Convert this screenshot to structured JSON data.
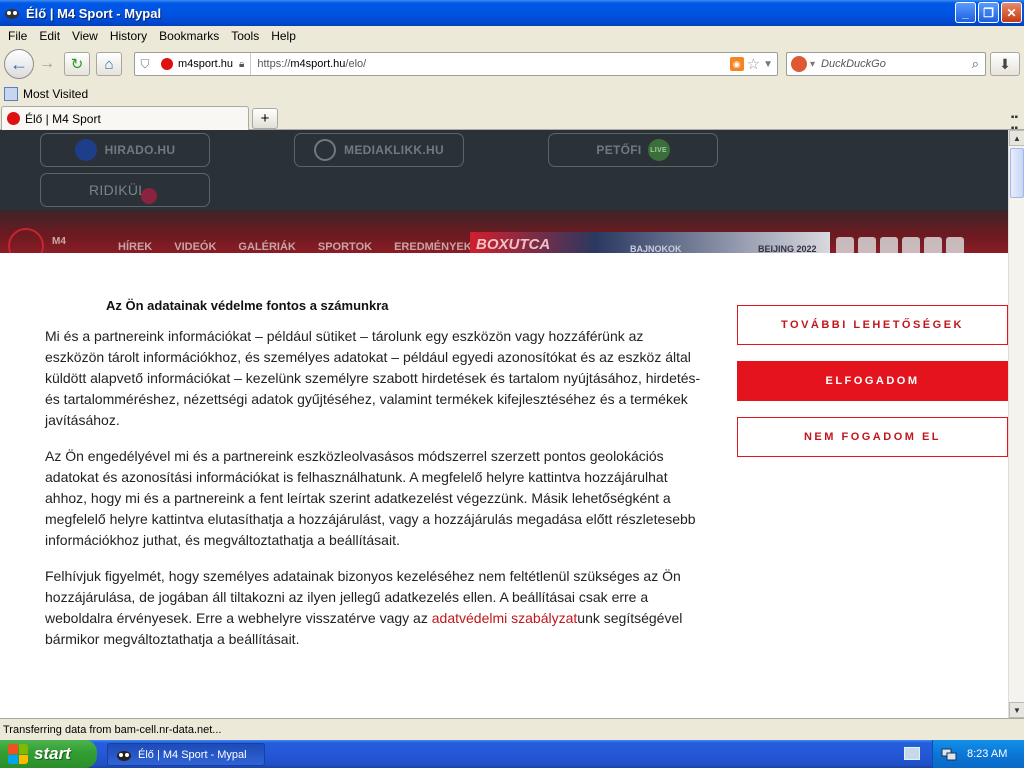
{
  "window": {
    "title": "Élő | M4 Sport - Mypal",
    "controls": {
      "minimize": "_",
      "maximize": "❐",
      "close": "✕"
    }
  },
  "menu": [
    "File",
    "Edit",
    "View",
    "History",
    "Bookmarks",
    "Tools",
    "Help"
  ],
  "nav": {
    "site_identity": "m4sport.hu",
    "url_prefix": "https://",
    "url_host": "m4sport.hu",
    "url_path": "/elo/",
    "search_placeholder": "DuckDuckGo"
  },
  "bookmarks": {
    "most_visited": "Most Visited"
  },
  "tabs": [
    {
      "label": "Élő | M4 Sport",
      "active": true
    }
  ],
  "site": {
    "portals": [
      "HIRADO.HU",
      "MEDIAKLIKK.HU",
      "PETŐFI",
      "RIDIKÜL"
    ],
    "petofi_badge": "LIVE",
    "m4_logo": "M4",
    "nav_items": [
      "HÍREK",
      "VIDEÓK",
      "GALÉRIÁK",
      "SPORTOK",
      "EREDMÉNYEK"
    ],
    "promos": [
      "BOXUTCA",
      "BAJNOKOK",
      "BEIJING 2022"
    ]
  },
  "consent": {
    "title": "Az Ön adatainak védelme fontos a számunkra",
    "p1": "Mi és a partnereink információkat – például sütiket – tárolunk egy eszközön vagy hozzáférünk az eszközön tárolt információkhoz, és személyes adatokat – például egyedi azonosítókat és az eszköz által küldött alapvető információkat – kezelünk személyre szabott hirdetések és tartalom nyújtásához, hirdetés- és tartalomméréshez, nézettségi adatok gyűjtéséhez, valamint termékek kifejlesztéséhez és a termékek javításához.",
    "p2": "Az Ön engedélyével mi és a partnereink eszközleolvasásos módszerrel szerzett pontos geolokációs adatokat és azonosítási információkat is felhasználhatunk. A megfelelő helyre kattintva hozzájárulhat ahhoz, hogy mi és a partnereink a fent leírtak szerint adatkezelést végezzünk. Másik lehetőségként a megfelelő helyre kattintva elutasíthatja a hozzájárulást, vagy a hozzájárulás megadása előtt részletesebb információkhoz juthat, és megváltoztathatja a beállításait.",
    "p3_before": "Felhívjuk figyelmét, hogy személyes adatainak bizonyos kezeléséhez nem feltétlenül szükséges az Ön hozzájárulása, de jogában áll tiltakozni az ilyen jellegű adatkezelés ellen. A beállításai csak erre a weboldalra érvényesek. Erre a webhelyre visszatérve vagy az ",
    "p3_link": "adatvédelmi szabályzat",
    "p3_after": "unk segítségével bármikor megváltoztathatja a beállításait.",
    "btn_more": "TOVÁBBI LEHETŐSÉGEK",
    "btn_accept": "ELFOGADOM",
    "btn_reject": "NEM FOGADOM EL"
  },
  "status": {
    "text": "Transferring data from bam-cell.nr-data.net..."
  },
  "taskbar": {
    "start_label": "start",
    "task_label": "Élő | M4 Sport - Mypal",
    "clock": "8:23 AM"
  },
  "colors": {
    "accent": "#e3141d",
    "xp_blue": "#0054e3",
    "site_dark": "#2a3238"
  }
}
